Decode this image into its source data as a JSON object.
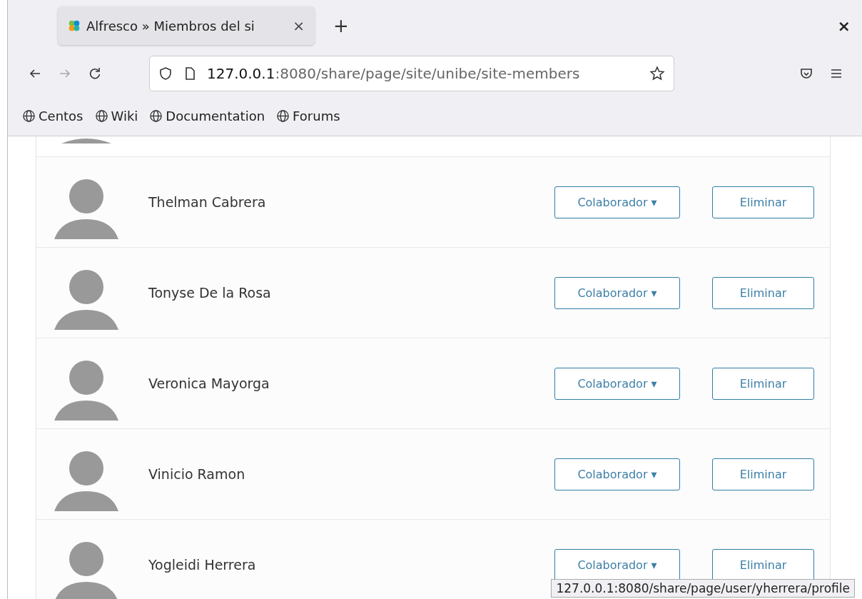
{
  "browser": {
    "tab": {
      "title": "Alfresco » Miembros del si",
      "close": "×",
      "selected": true
    },
    "new_tab": "+",
    "window_close": "×",
    "address": {
      "host": "127.0.0.1",
      "path": ":8080/share/page/site/unibe/site-members"
    },
    "bookmarks": [
      "Centos",
      "Wiki",
      "Documentation",
      "Forums"
    ]
  },
  "members": [
    {
      "name": "Thelman Cabrera",
      "role": "Colaborador ▾",
      "remove": "Eliminar"
    },
    {
      "name": "Tonyse De la Rosa",
      "role": "Colaborador ▾",
      "remove": "Eliminar"
    },
    {
      "name": "Veronica Mayorga",
      "role": "Colaborador ▾",
      "remove": "Eliminar"
    },
    {
      "name": "Vinicio Ramon",
      "role": "Colaborador ▾",
      "remove": "Eliminar"
    },
    {
      "name": "Yogleidi Herrera",
      "role": "Colaborador ▾",
      "remove": "Eliminar"
    }
  ],
  "status_link": "127.0.0.1:8080/share/page/user/yherrera/profile"
}
